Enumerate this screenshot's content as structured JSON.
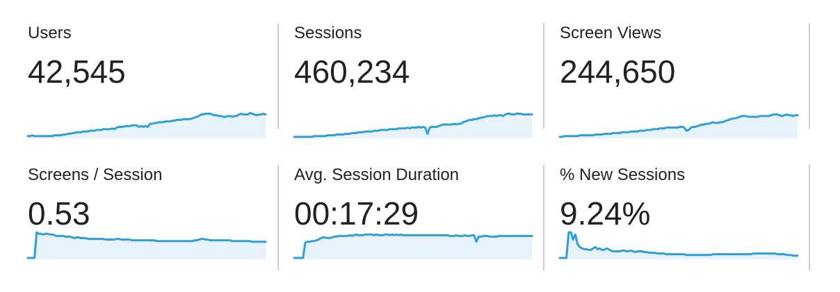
{
  "colors": {
    "line": "#2f9fd8",
    "fill": "#e7f2fb",
    "divider": "#cccccc",
    "text": "#222222"
  },
  "metrics": [
    {
      "label": "Users",
      "value": "42,545",
      "sparkline": [
        2,
        2,
        3,
        2,
        2,
        2,
        2,
        2,
        2,
        2,
        2,
        2,
        3,
        3,
        3,
        3,
        4,
        4,
        5,
        5,
        6,
        6,
        7,
        7,
        7,
        8,
        8,
        8,
        9,
        9,
        9,
        10,
        10,
        10,
        11,
        11,
        11,
        11,
        12,
        11,
        13,
        14,
        14,
        14,
        15,
        15,
        15,
        16,
        16,
        16,
        14,
        15,
        14,
        15,
        14,
        18,
        18,
        19,
        19,
        20,
        20,
        20,
        21,
        21,
        21,
        22,
        22,
        23,
        23,
        23,
        24,
        24,
        24,
        24,
        25,
        26,
        27,
        28,
        30,
        30,
        31,
        31,
        31,
        30,
        29,
        29,
        28,
        28,
        27,
        27,
        28,
        28,
        27,
        28,
        28,
        30,
        31,
        30,
        30,
        30,
        32,
        31,
        30,
        29,
        30,
        30,
        31,
        30
      ]
    },
    {
      "label": "Sessions",
      "value": "460,234",
      "sparkline": [
        1,
        1,
        1,
        1,
        1,
        1,
        1,
        1,
        1,
        2,
        2,
        2,
        2,
        2,
        2,
        3,
        3,
        3,
        3,
        4,
        4,
        4,
        4,
        5,
        5,
        5,
        6,
        6,
        6,
        7,
        7,
        7,
        8,
        8,
        8,
        8,
        9,
        9,
        9,
        10,
        10,
        10,
        10,
        11,
        11,
        11,
        11,
        12,
        12,
        12,
        12,
        13,
        12,
        13,
        13,
        13,
        14,
        13,
        14,
        13,
        5,
        13,
        14,
        14,
        14,
        15,
        16,
        17,
        17,
        17,
        17,
        17,
        18,
        17,
        18,
        18,
        20,
        21,
        22,
        23,
        23,
        24,
        24,
        25,
        26,
        26,
        27,
        28,
        28,
        28,
        29,
        28,
        29,
        29,
        28,
        30,
        31,
        31,
        30,
        30,
        31,
        31,
        31,
        30,
        30,
        30,
        30,
        30
      ]
    },
    {
      "label": "Screen Views",
      "value": "244,650",
      "sparkline": [
        1,
        1,
        2,
        2,
        2,
        2,
        2,
        2,
        2,
        3,
        3,
        3,
        3,
        3,
        3,
        3,
        4,
        4,
        4,
        4,
        5,
        5,
        5,
        5,
        6,
        6,
        6,
        6,
        7,
        7,
        7,
        7,
        8,
        8,
        8,
        8,
        9,
        9,
        9,
        10,
        10,
        10,
        11,
        11,
        11,
        12,
        12,
        12,
        13,
        13,
        13,
        13,
        13,
        13,
        14,
        14,
        13,
        9,
        10,
        13,
        14,
        14,
        15,
        16,
        17,
        17,
        18,
        18,
        19,
        20,
        19,
        19,
        20,
        20,
        21,
        22,
        23,
        24,
        25,
        25,
        26,
        27,
        28,
        28,
        28,
        27,
        27,
        27,
        27,
        27,
        28,
        28,
        28,
        28,
        28,
        29,
        30,
        30,
        30,
        29,
        28,
        29,
        30,
        29,
        29,
        28,
        29,
        29
      ]
    },
    {
      "label": "Screens / Session",
      "value": "0.53",
      "sparkline": [
        1,
        1,
        1,
        1,
        36,
        34,
        34,
        33,
        34,
        34,
        33,
        33,
        32,
        31,
        31,
        31,
        31,
        30,
        30,
        30,
        29,
        28,
        29,
        29,
        28,
        28,
        28,
        27,
        27,
        27,
        27,
        27,
        27,
        27,
        27,
        26,
        26,
        26,
        26,
        26,
        27,
        27,
        26,
        26,
        26,
        26,
        26,
        25,
        25,
        25,
        25,
        25,
        25,
        25,
        25,
        25,
        25,
        25,
        24,
        24,
        24,
        24,
        24,
        24,
        24,
        24,
        24,
        24,
        24,
        24,
        24,
        24,
        24,
        24,
        24,
        25,
        25,
        26,
        27,
        27,
        26,
        26,
        25,
        25,
        25,
        25,
        25,
        25,
        25,
        25,
        25,
        25,
        24,
        24,
        24,
        24,
        24,
        24,
        24,
        24,
        24,
        23,
        23,
        23,
        23,
        23,
        23,
        23
      ]
    },
    {
      "label": "Avg. Session Duration",
      "value": "00:17:29",
      "sparkline": [
        1,
        1,
        1,
        1,
        1,
        22,
        23,
        23,
        24,
        24,
        25,
        26,
        28,
        29,
        29,
        28,
        28,
        29,
        30,
        30,
        31,
        31,
        31,
        31,
        31,
        32,
        31,
        32,
        33,
        32,
        32,
        32,
        33,
        33,
        33,
        33,
        32,
        33,
        32,
        32,
        32,
        33,
        33,
        32,
        33,
        32,
        33,
        32,
        33,
        32,
        32,
        32,
        32,
        32,
        32,
        32,
        32,
        32,
        32,
        32,
        32,
        32,
        32,
        32,
        32,
        32,
        32,
        32,
        32,
        32,
        31,
        31,
        31,
        32,
        31,
        31,
        31,
        32,
        31,
        31,
        32,
        32,
        23,
        30,
        30,
        31,
        31,
        31,
        30,
        30,
        30,
        30,
        31,
        31,
        31,
        31,
        31,
        31,
        31,
        31,
        31,
        31,
        31,
        31,
        31,
        31,
        31,
        31
      ]
    },
    {
      "label": "% New Sessions",
      "value": "9.24%",
      "sparkline": [
        1,
        1,
        1,
        1,
        36,
        36,
        26,
        33,
        20,
        16,
        14,
        13,
        13,
        12,
        12,
        14,
        16,
        13,
        14,
        12,
        12,
        14,
        13,
        11,
        10,
        10,
        10,
        10,
        11,
        11,
        10,
        10,
        11,
        10,
        9,
        10,
        10,
        10,
        9,
        9,
        8,
        8,
        8,
        8,
        7,
        7,
        7,
        7,
        6,
        6,
        6,
        6,
        6,
        6,
        6,
        6,
        6,
        5,
        5,
        5,
        5,
        5,
        5,
        5,
        5,
        5,
        5,
        5,
        5,
        6,
        6,
        6,
        6,
        6,
        6,
        6,
        6,
        6,
        6,
        6,
        6,
        6,
        6,
        6,
        6,
        6,
        6,
        7,
        7,
        7,
        7,
        7,
        7,
        7,
        7,
        7,
        7,
        7,
        6,
        6,
        6,
        6,
        5,
        5,
        5,
        4,
        4,
        4
      ]
    }
  ]
}
